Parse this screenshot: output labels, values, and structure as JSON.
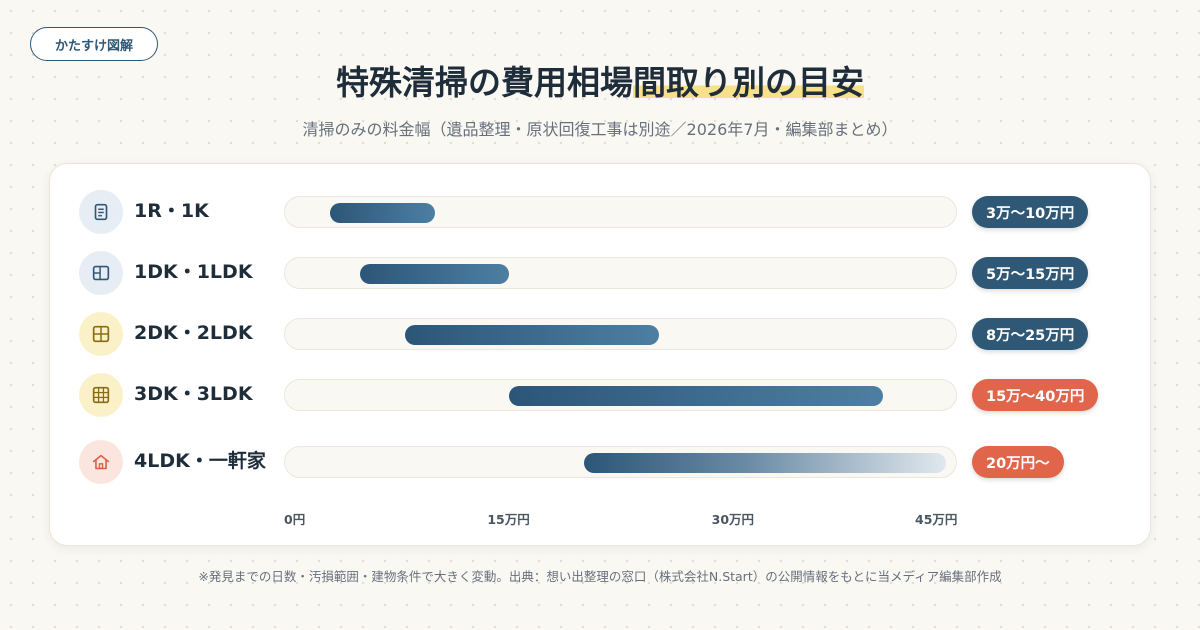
{
  "badge": {
    "label": "かたすけ図解"
  },
  "header": {
    "title_part1": "特殊清掃の費用相場",
    "title_part2": "間取り別の目安",
    "subtitle": "清掃のみの料金幅（遺品整理・原状回復工事は別途／2026年7月・編集部まとめ）"
  },
  "chart_data": {
    "type": "range-bar",
    "unit": "万円",
    "x_axis": {
      "min": 0,
      "max": 45,
      "ticks": [
        0,
        15,
        30,
        45
      ],
      "tick_labels": [
        "0円",
        "15万円",
        "30万円",
        "45万円"
      ]
    },
    "rows": [
      {
        "category": "1R・1K",
        "low": 3,
        "high": 10,
        "label": "3万〜10万円",
        "icon": "document-icon",
        "icon_bg": "#e6edf4",
        "icon_color": "#2f5877",
        "pill_color": "#2f5877"
      },
      {
        "category": "1DK・1LDK",
        "low": 5,
        "high": 15,
        "label": "5万〜15万円",
        "icon": "layout-panel-icon",
        "icon_bg": "#e6edf4",
        "icon_color": "#2f5877",
        "pill_color": "#2f5877"
      },
      {
        "category": "2DK・2LDK",
        "low": 8,
        "high": 25,
        "label": "8万〜25万円",
        "icon": "grid-four-icon",
        "icon_bg": "#fbf1c9",
        "icon_color": "#8a6a12",
        "pill_color": "#2f5877"
      },
      {
        "category": "3DK・3LDK",
        "low": 15,
        "high": 40,
        "label": "15万〜40万円",
        "icon": "grid-nine-icon",
        "icon_bg": "#fbf1c9",
        "icon_color": "#8a6a12",
        "pill_color": "#e0654a"
      },
      {
        "category": "4LDK・一軒家",
        "low": 20,
        "high": null,
        "label": "20万円〜",
        "icon": "house-icon",
        "icon_bg": "#fbe6df",
        "icon_color": "#d8634a",
        "pill_color": "#e0654a"
      }
    ]
  },
  "footnote": "※発見までの日数・汚損範囲・建物条件で大きく変動。出典：想い出整理の窓口（株式会社N.Start）の公開情報をもとに当メディア編集部作成"
}
